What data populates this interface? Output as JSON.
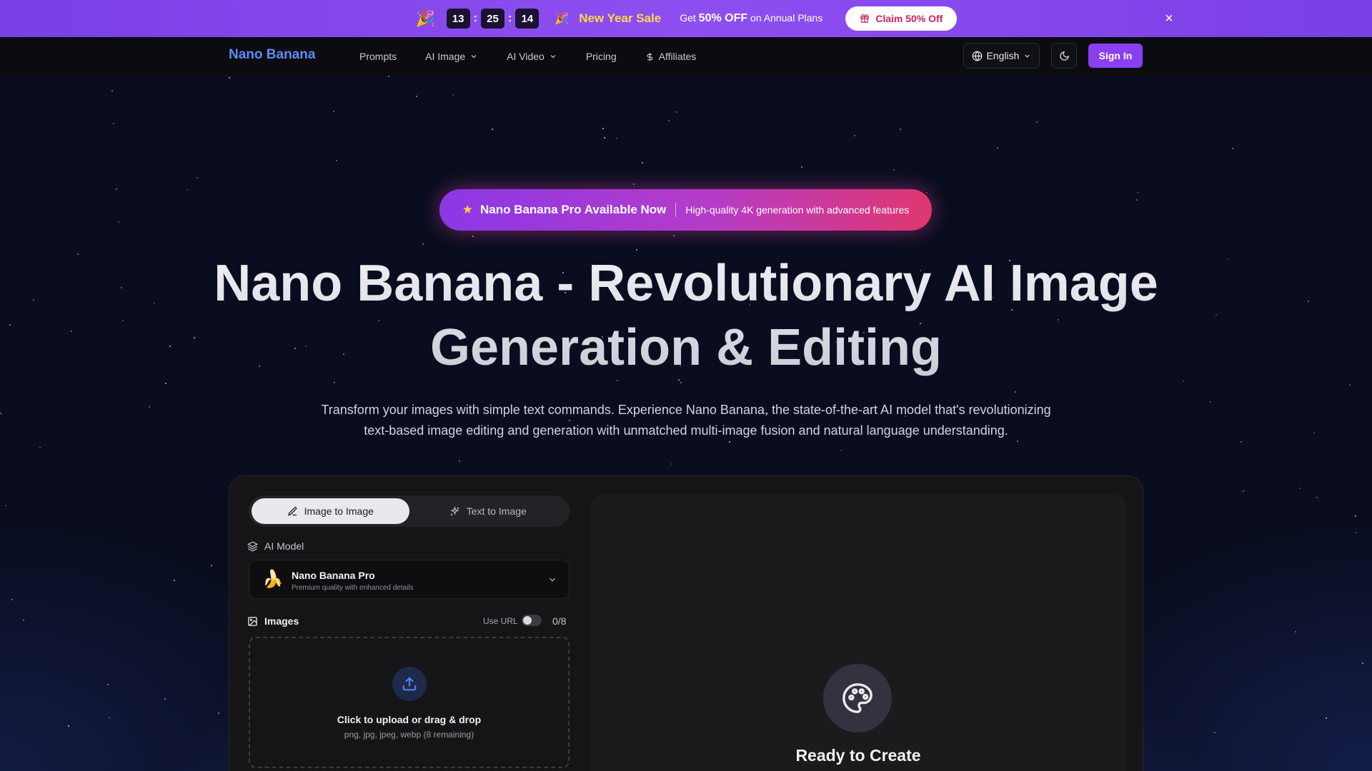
{
  "promo": {
    "timer": {
      "hours": "13",
      "minutes": "25",
      "seconds": "14",
      "separator": ":"
    },
    "sale_title": "New Year Sale",
    "offer_prefix": "Get ",
    "offer_highlight": "50% OFF",
    "offer_suffix": " on Annual Plans",
    "claim_label": "Claim 50% Off",
    "close_symbol": "×"
  },
  "nav": {
    "brand": "Nano Banana",
    "links": [
      "Prompts",
      "AI Image",
      "AI Video",
      "Pricing",
      "Affiliates"
    ],
    "language": "English",
    "sign_in": "Sign In"
  },
  "hero": {
    "pill_title": "Nano Banana Pro Available Now",
    "pill_subtitle": "High-quality 4K generation with advanced features",
    "title_line1": "Nano Banana - Revolutionary AI Image",
    "title_line2": "Generation & Editing",
    "description": "Transform your images with simple text commands. Experience Nano Banana, the state-of-the-art AI model that's revolutionizing text-based image editing and generation with unmatched multi-image fusion and natural language understanding."
  },
  "generator": {
    "tabs": [
      {
        "label": "Image to Image",
        "active": true
      },
      {
        "label": "Text to Image",
        "active": false
      }
    ],
    "model_label": "AI Model",
    "model": {
      "name": "Nano Banana Pro",
      "description": "Premium quality with enhanced details"
    },
    "images_label": "Images",
    "use_url_label": "Use URL",
    "use_url_enabled": false,
    "image_count": "0/8",
    "upload_title": "Click to upload or drag & drop",
    "upload_hint": "png, jpg, jpeg, webp (8 remaining)",
    "output_title": "Ready to Create"
  },
  "colors": {
    "accent": "#8a3ff0",
    "brand": "#5d8cf5",
    "sale": "#ffd84a",
    "claim_text": "#d0245a",
    "background": "#090d1f"
  }
}
